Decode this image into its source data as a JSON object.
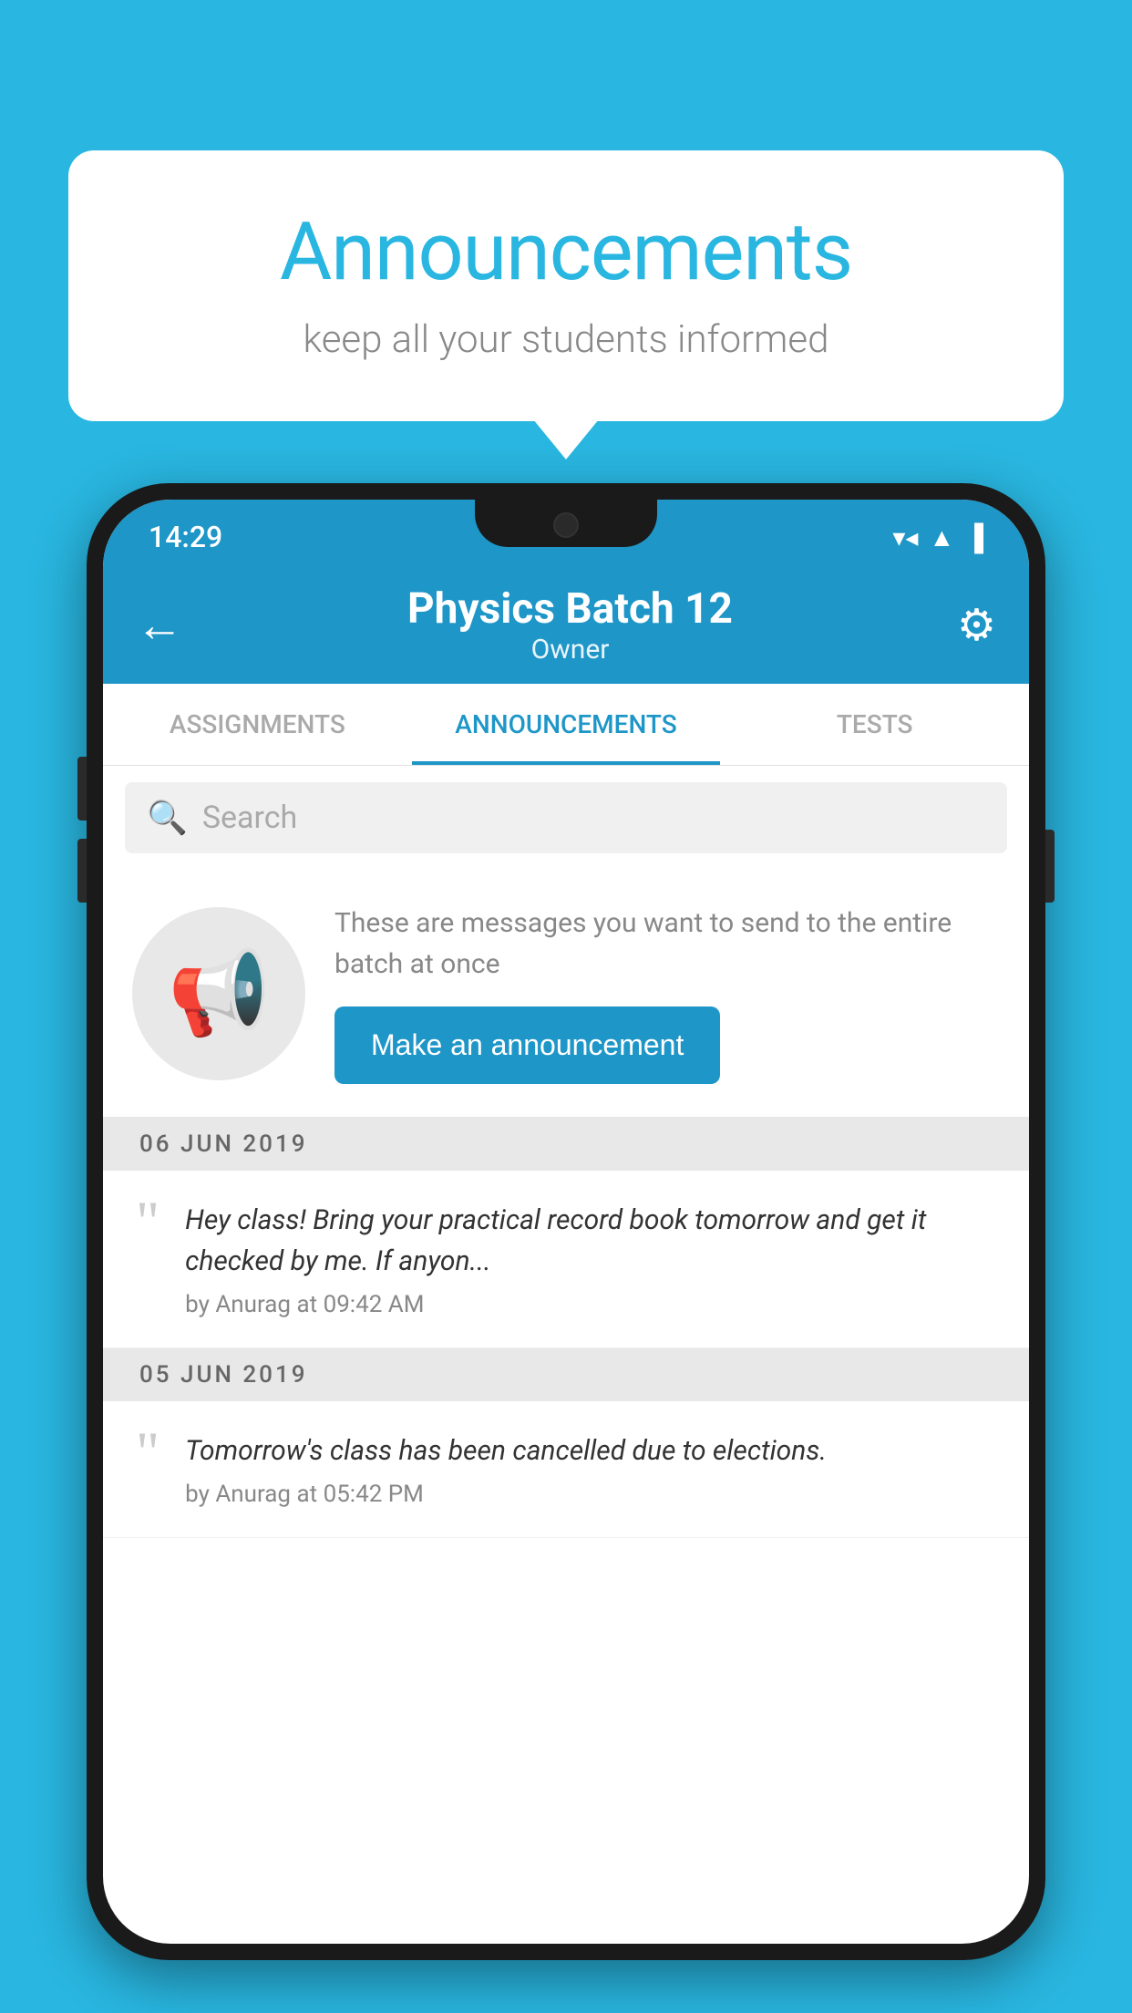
{
  "background_color": "#29b6e0",
  "speech_bubble": {
    "title": "Announcements",
    "subtitle": "keep all your students informed"
  },
  "phone": {
    "status_bar": {
      "time": "14:29",
      "wifi": "▼▲",
      "signal": "▲",
      "battery": "▌"
    },
    "app_bar": {
      "back_label": "←",
      "title": "Physics Batch 12",
      "subtitle": "Owner",
      "gear_label": "⚙"
    },
    "tabs": [
      {
        "label": "ASSIGNMENTS",
        "active": false
      },
      {
        "label": "ANNOUNCEMENTS",
        "active": true
      },
      {
        "label": "TESTS",
        "active": false
      }
    ],
    "search": {
      "placeholder": "Search"
    },
    "promo": {
      "description": "These are messages you want to send to the entire batch at once",
      "button_label": "Make an announcement"
    },
    "announcements": [
      {
        "date_separator": "06  JUN  2019",
        "text": "Hey class! Bring your practical record book tomorrow and get it checked by me. If anyon...",
        "meta": "by Anurag at 09:42 AM"
      },
      {
        "date_separator": "05  JUN  2019",
        "text": "Tomorrow's class has been cancelled due to elections.",
        "meta": "by Anurag at 05:42 PM"
      }
    ]
  }
}
